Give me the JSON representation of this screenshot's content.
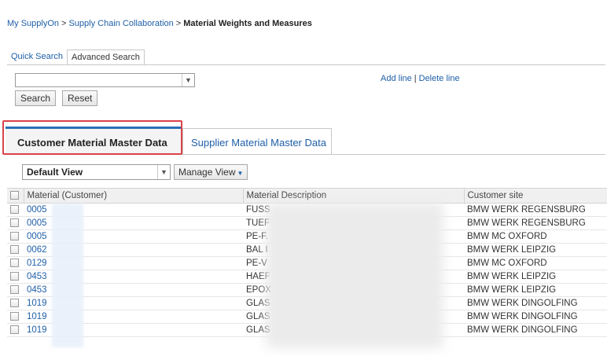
{
  "breadcrumb": {
    "items": [
      "My SupplyOn",
      "Supply Chain Collaboration"
    ],
    "separator": ">",
    "current": "Material Weights and Measures"
  },
  "search_tabs": {
    "quick": "Quick Search",
    "advanced": "Advanced Search"
  },
  "search": {
    "select_value": "",
    "search_button": "Search",
    "reset_button": "Reset"
  },
  "line_actions": {
    "add": "Add line",
    "separator": "|",
    "delete": "Delete line"
  },
  "data_tabs": {
    "customer": "Customer Material Master Data",
    "supplier": "Supplier Material Master Data"
  },
  "view": {
    "selected": "Default View",
    "manage_label": "Manage View"
  },
  "table": {
    "columns": [
      "Material (Customer)",
      "Material Description",
      "Customer site"
    ],
    "rows": [
      {
        "material": "0005",
        "description": "FUSS",
        "site": "BMW WERK REGENSBURG"
      },
      {
        "material": "0005",
        "description": "TUEF",
        "site": "BMW WERK REGENSBURG"
      },
      {
        "material": "0005",
        "description": "PE-F.",
        "site": "BMW MC OXFORD"
      },
      {
        "material": "0062",
        "description": "BAL I",
        "site": "BMW WERK LEIPZIG"
      },
      {
        "material": "0129",
        "description": "PE-V",
        "site": "BMW MC OXFORD"
      },
      {
        "material": "0453",
        "description": "HAEF",
        "site": "BMW WERK LEIPZIG"
      },
      {
        "material": "0453",
        "description": "EPOX",
        "site": "BMW WERK LEIPZIG"
      },
      {
        "material": "1019",
        "description": "GLAS",
        "site": "BMW WERK DINGOLFING"
      },
      {
        "material": "1019",
        "description": "GLAS",
        "site": "BMW WERK DINGOLFING"
      },
      {
        "material": "1019",
        "description": "GLAS",
        "site": "BMW WERK DINGOLFING"
      }
    ]
  },
  "colors": {
    "link": "#1f5fa8",
    "highlight_border": "#d9434a",
    "active_tab_accent": "#2a6fb7"
  },
  "icons": {
    "dropdown": "chevron-down-icon",
    "checkbox": "checkbox-icon"
  }
}
